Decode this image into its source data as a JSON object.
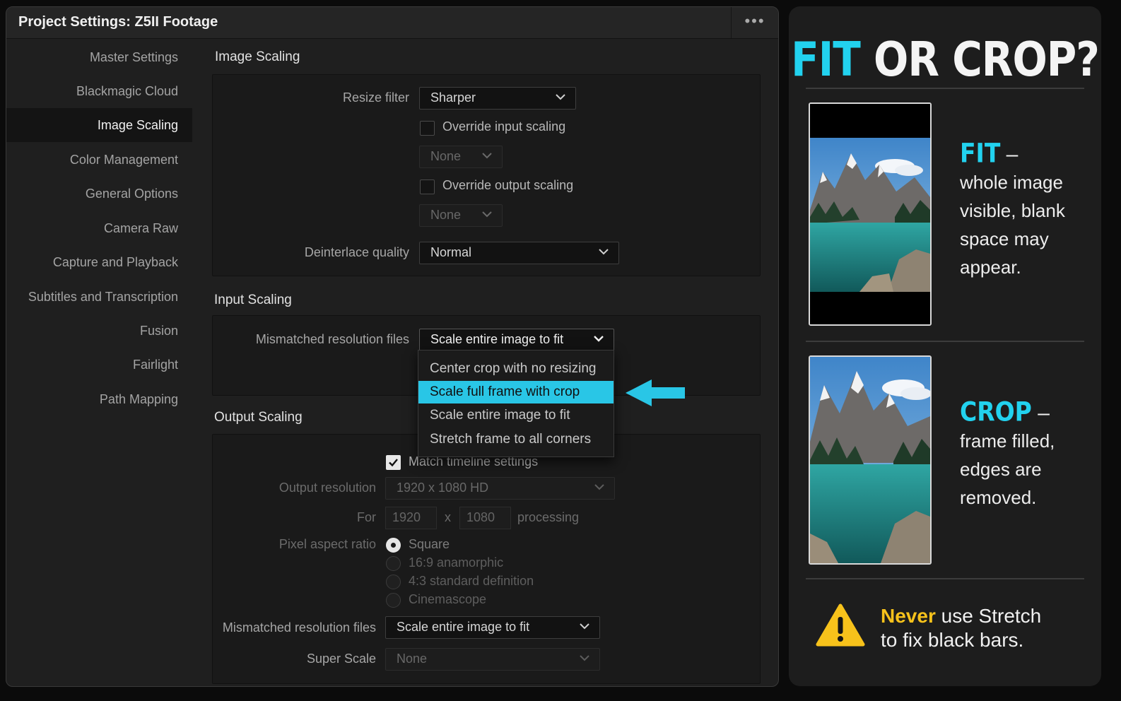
{
  "window": {
    "title": "Project Settings:  Z5II Footage",
    "more_glyph": "•••"
  },
  "sidebar": {
    "items": [
      {
        "label": "Master Settings"
      },
      {
        "label": "Blackmagic Cloud"
      },
      {
        "label": "Image Scaling",
        "selected": true
      },
      {
        "label": "Color Management"
      },
      {
        "label": "General Options"
      },
      {
        "label": "Camera Raw"
      },
      {
        "label": "Capture and Playback"
      },
      {
        "label": "Subtitles and Transcription"
      },
      {
        "label": "Fusion"
      },
      {
        "label": "Fairlight"
      },
      {
        "label": "Path Mapping"
      }
    ]
  },
  "image_scaling": {
    "title": "Image Scaling",
    "resize_filter_label": "Resize filter",
    "resize_filter_value": "Sharper",
    "override_input_label": "Override input scaling",
    "override_input_value": "None",
    "override_output_label": "Override output scaling",
    "override_output_value": "None",
    "deinterlace_label": "Deinterlace quality",
    "deinterlace_value": "Normal"
  },
  "input_scaling": {
    "title": "Input Scaling",
    "mismatched_label": "Mismatched resolution files",
    "mismatched_value": "Scale entire image to fit",
    "menu_options": [
      {
        "label": "Center crop with no resizing"
      },
      {
        "label": "Scale full frame with crop",
        "highlighted": true
      },
      {
        "label": "Scale entire image to fit"
      },
      {
        "label": "Stretch frame to all corners"
      }
    ]
  },
  "output_scaling": {
    "title": "Output Scaling",
    "match_timeline_label": "Match timeline settings",
    "match_timeline_checked": true,
    "output_resolution_label": "Output resolution",
    "output_resolution_value": "1920 x 1080 HD",
    "for_label": "For",
    "width": "1920",
    "x_label": "x",
    "height": "1080",
    "processing_label": "processing",
    "pixel_aspect_label": "Pixel aspect ratio",
    "pixel_aspect_options": [
      {
        "label": "Square",
        "selected": true
      },
      {
        "label": "16:9 anamorphic"
      },
      {
        "label": "4:3 standard definition"
      },
      {
        "label": "Cinemascope"
      }
    ],
    "mismatched_label": "Mismatched resolution files",
    "mismatched_value": "Scale entire image to fit",
    "super_scale_label": "Super Scale",
    "super_scale_value": "None"
  },
  "panel": {
    "headline_accent": "FIT",
    "headline_rest": " OR CROP?",
    "fit_term": "FIT",
    "fit_dash": " –",
    "fit_desc": "whole image visible, blank space may appear.",
    "crop_term": "CROP",
    "crop_dash": " –",
    "crop_desc": "frame filled, edges are removed.",
    "warning_emphasis": "Never",
    "warning_line1_rest": " use Stretch",
    "warning_line2": "to fix black bars."
  },
  "colors": {
    "accent_cyan": "#22d2ef",
    "highlight_cyan": "#29c6e6",
    "warning_yellow": "#f7c21b"
  },
  "icons": [
    "more-icon",
    "chevron-down-icon",
    "checkmark-icon",
    "arrow-left-icon",
    "warning-icon"
  ]
}
